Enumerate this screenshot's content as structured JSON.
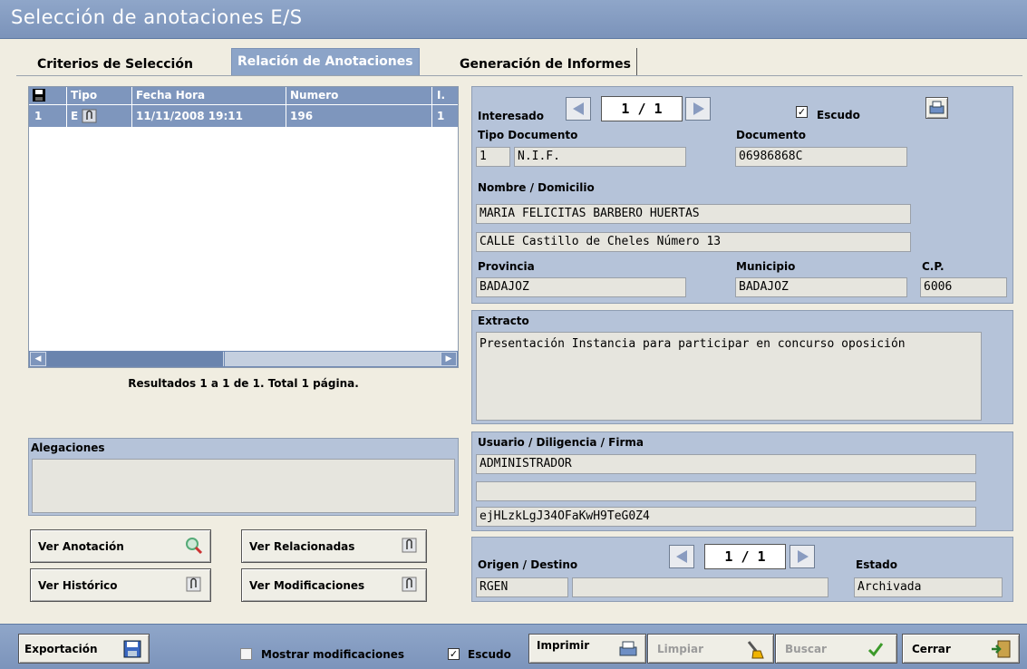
{
  "window": {
    "title": "Selección de anotaciones E/S"
  },
  "tabs": [
    {
      "label": "Criterios de Selección"
    },
    {
      "label": "Relación de Anotaciones"
    },
    {
      "label": "Generación de Informes"
    }
  ],
  "grid": {
    "columns": [
      "Tipo",
      "Fecha Hora",
      "Numero",
      "I."
    ],
    "rows": [
      {
        "index": "1",
        "tipo": "E",
        "fecha_hora": "11/11/2008 19:11",
        "numero": "196",
        "i": "1"
      }
    ],
    "results_text": "Resultados 1 a 1 de 1. Total 1 página."
  },
  "interesado": {
    "label": "Interesado",
    "pager": "1 / 1",
    "escudo_label": "Escudo",
    "escudo_checked": true,
    "tipo_documento_label": "Tipo Documento",
    "tipo_documento_code": "1",
    "tipo_documento_value": "N.I.F.",
    "documento_label": "Documento",
    "documento_value": "06986868C",
    "nombre_label": "Nombre / Domicilio",
    "nombre_value": "MARIA FELICITAS BARBERO HUERTAS",
    "domicilio_value": "CALLE Castillo de Cheles Número 13",
    "provincia_label": "Provincia",
    "provincia_value": "BADAJOZ",
    "municipio_label": "Municipio",
    "municipio_value": "BADAJOZ",
    "cp_label": "C.P.",
    "cp_value": "6006"
  },
  "extracto": {
    "label": "Extracto",
    "value": "Presentación Instancia para participar en concurso oposición"
  },
  "usuario": {
    "label": "Usuario / Diligencia / Firma",
    "usuario_value": "ADMINISTRADOR",
    "diligencia_value": "",
    "firma_value": "ejHLzkLgJ34OFaKwH9TeG0Z4"
  },
  "origen": {
    "label": "Origen / Destino",
    "pager": "1 / 1",
    "origen_value": "RGEN",
    "destino_value": "",
    "estado_label": "Estado",
    "estado_value": "Archivada"
  },
  "alegaciones": {
    "label": "Alegaciones",
    "value": ""
  },
  "actions": {
    "ver_anotacion": "Ver Anotación",
    "ver_relacionadas": "Ver Relacionadas",
    "ver_historico": "Ver Histórico",
    "ver_modificaciones": "Ver Modificaciones"
  },
  "bottom": {
    "exportacion": "Exportación",
    "mostrar_modificaciones": "Mostrar modificaciones",
    "mostrar_modificaciones_checked": false,
    "escudo": "Escudo",
    "escudo_checked": true,
    "imprimir": "Imprimir",
    "limpiar": "Limpiar",
    "buscar": "Buscar",
    "cerrar": "Cerrar"
  },
  "colors": {
    "titlebar": "#8fa6c9",
    "panel": "#b5c3d9",
    "grid_header": "#7e96bd",
    "background": "#f0ede1"
  }
}
